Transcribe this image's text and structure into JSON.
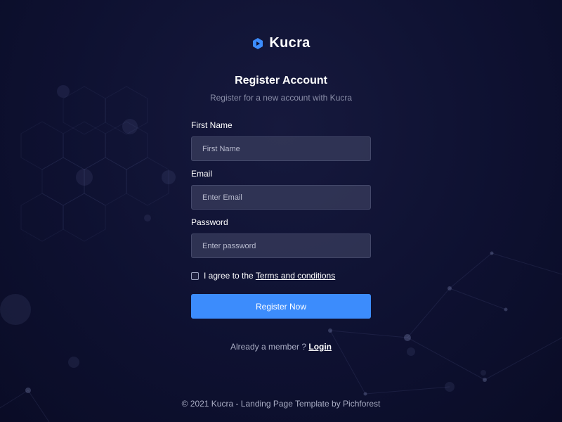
{
  "brand": {
    "name": "Kucra",
    "icon": "hexagon-logo-icon",
    "accent": "#3c8cfc"
  },
  "header": {
    "title": "Register Account",
    "subtitle": "Register for a new account with Kucra"
  },
  "form": {
    "first_name": {
      "label": "First Name",
      "placeholder": "First Name",
      "value": ""
    },
    "email": {
      "label": "Email",
      "placeholder": "Enter Email",
      "value": ""
    },
    "password": {
      "label": "Password",
      "placeholder": "Enter password",
      "value": ""
    },
    "terms": {
      "prefix": "I agree to the ",
      "link": "Terms and conditions",
      "checked": false
    },
    "submit_label": "Register Now"
  },
  "member": {
    "text": "Already a member ? ",
    "link": "Login"
  },
  "footer": {
    "text": "© 2021 Kucra - Landing Page Template by Pichforest"
  },
  "colors": {
    "background": "#0e1131",
    "input_bg": "#3a3e5e",
    "button": "#3c8cfc",
    "muted_text": "#a9adc4"
  }
}
